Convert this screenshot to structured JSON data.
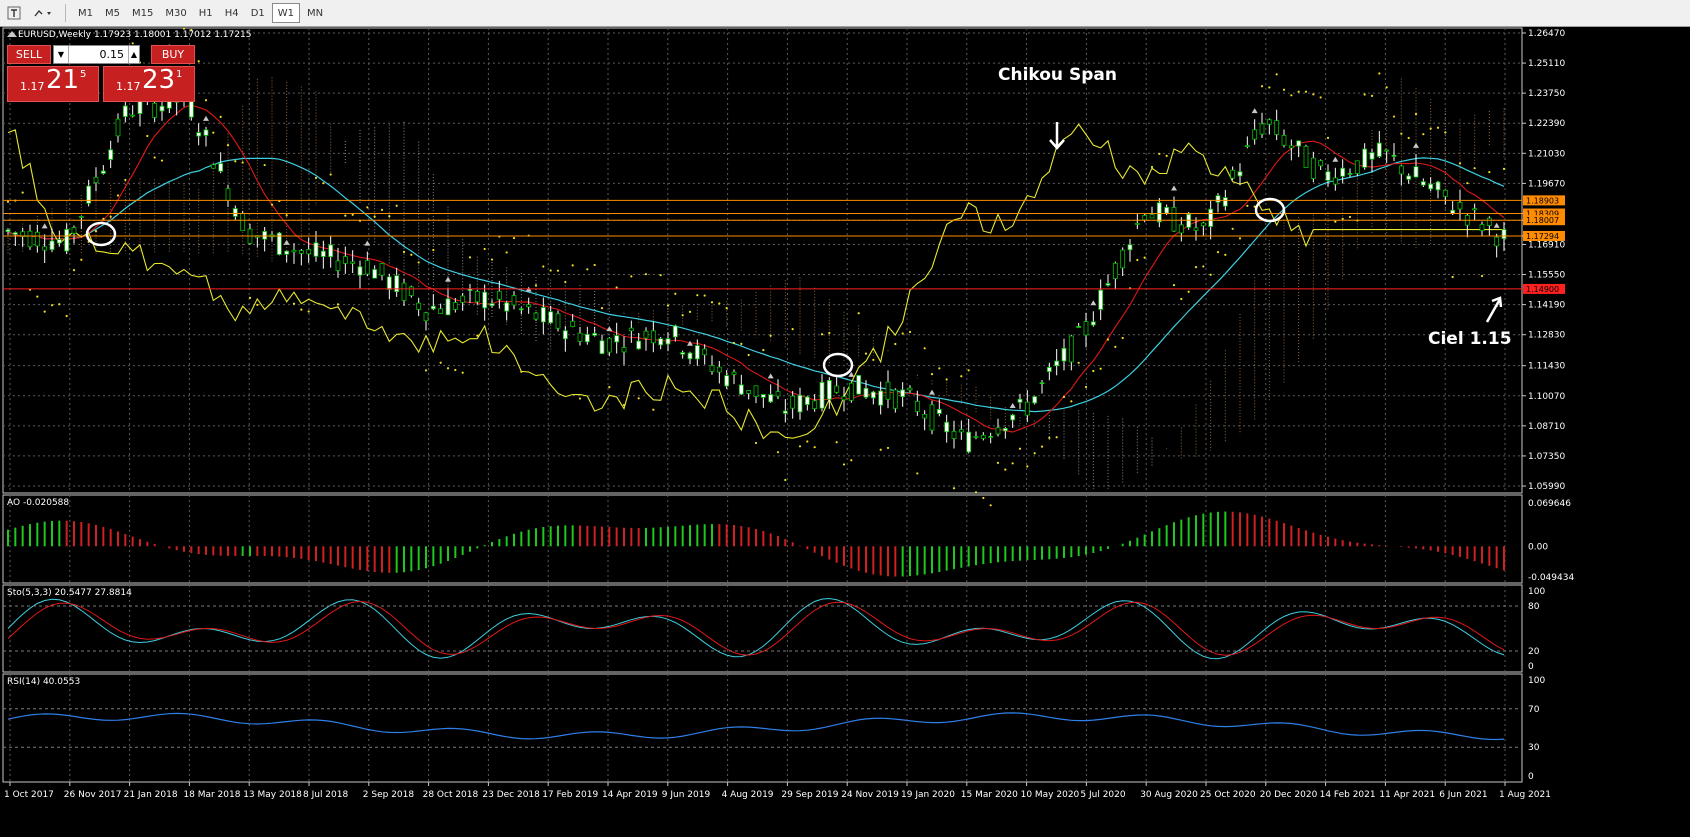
{
  "toolbar": {
    "timeframes": [
      "M1",
      "M5",
      "M15",
      "M30",
      "H1",
      "H4",
      "D1",
      "W1",
      "MN"
    ],
    "active": "W1"
  },
  "main_chart": {
    "header": "EURUSD,Weekly  1.17923 1.18001 1.17012 1.17215",
    "price_ticks": [
      "1.26470",
      "1.25110",
      "1.23750",
      "1.22390",
      "1.21030",
      "1.19670",
      "1.18309",
      "1.18007",
      "1.17294",
      "1.16910",
      "1.15550",
      "1.14190",
      "1.12830",
      "1.11430",
      "1.10070",
      "1.08710",
      "1.07350",
      "1.05990"
    ],
    "price_range": [
      1.0599,
      1.2647
    ],
    "level_labels": [
      {
        "text": "1.18903",
        "price": 1.18903,
        "color": "#ff8c00"
      },
      {
        "text": "1.18309",
        "price": 1.18309,
        "color": "#ff8c00"
      },
      {
        "text": "1.18007",
        "price": 1.18007,
        "color": "#ff8c00"
      },
      {
        "text": "1.17294",
        "price": 1.17294,
        "color": "#ff8c00"
      },
      {
        "text": "1.14900",
        "price": 1.149,
        "color": "#ff2020"
      }
    ],
    "annotations": {
      "chikou": "Chikou Span",
      "ciel": "Ciel 1.15"
    }
  },
  "trade_panel": {
    "sell_label": "SELL",
    "buy_label": "BUY",
    "lot": "0.15",
    "sell_small": "1.17",
    "sell_big": "21",
    "sell_pip": "5",
    "buy_small": "1.17",
    "buy_big": "23",
    "buy_pip": "1"
  },
  "ao_panel": {
    "header": "AO -0.020588",
    "ticks": [
      "0.069646",
      "0.00",
      "-0.049434"
    ],
    "range": [
      -0.049434,
      0.069646
    ]
  },
  "sto_panel": {
    "header": "Sto(5,3,3) 20.5477 27.8814",
    "ticks": [
      "100",
      "80",
      "20",
      "0"
    ]
  },
  "rsi_panel": {
    "header": "RSI(14) 40.0553",
    "ticks": [
      "100",
      "70",
      "30",
      "0"
    ]
  },
  "time_axis": [
    "1 Oct 2017",
    "26 Nov 2017",
    "21 Jan 2018",
    "18 Mar 2018",
    "13 May 2018",
    "8 Jul 2018",
    "2 Sep 2018",
    "28 Oct 2018",
    "23 Dec 2018",
    "17 Feb 2019",
    "14 Apr 2019",
    "9 Jun 2019",
    "4 Aug 2019",
    "29 Sep 2019",
    "24 Nov 2019",
    "19 Jan 2020",
    "15 Mar 2020",
    "10 May 2020",
    "5 Jul 2020",
    "30 Aug 2020",
    "25 Oct 2020",
    "20 Dec 2020",
    "14 Feb 2021",
    "11 Apr 2021",
    "6 Jun 2021",
    "1 Aug 2021"
  ],
  "chart_data": {
    "type": "line",
    "title": "EURUSD,Weekly",
    "symbol": "EURUSD",
    "timeframe": "Weekly",
    "last_bar": {
      "open": 1.17923,
      "high": 1.18001,
      "low": 1.17012,
      "close": 1.17215
    },
    "price_key_points": [
      {
        "x": "1 Oct 2017",
        "y": 1.175
      },
      {
        "x": "26 Nov 2017",
        "y": 1.17
      },
      {
        "x": "21 Jan 2018",
        "y": 1.23
      },
      {
        "x": "18 Mar 2018",
        "y": 1.235
      },
      {
        "x": "13 May 2018",
        "y": 1.175
      },
      {
        "x": "8 Jul 2018",
        "y": 1.165
      },
      {
        "x": "2 Sep 2018",
        "y": 1.16
      },
      {
        "x": "28 Oct 2018",
        "y": 1.14
      },
      {
        "x": "23 Dec 2018",
        "y": 1.145
      },
      {
        "x": "17 Feb 2019",
        "y": 1.135
      },
      {
        "x": "14 Apr 2019",
        "y": 1.125
      },
      {
        "x": "9 Jun 2019",
        "y": 1.13
      },
      {
        "x": "4 Aug 2019",
        "y": 1.11
      },
      {
        "x": "29 Sep 2019",
        "y": 1.095
      },
      {
        "x": "24 Nov 2019",
        "y": 1.105
      },
      {
        "x": "19 Jan 2020",
        "y": 1.1
      },
      {
        "x": "15 Mar 2020",
        "y": 1.08
      },
      {
        "x": "10 May 2020",
        "y": 1.095
      },
      {
        "x": "5 Jul 2020",
        "y": 1.13
      },
      {
        "x": "30 Aug 2020",
        "y": 1.185
      },
      {
        "x": "25 Oct 2020",
        "y": 1.175
      },
      {
        "x": "20 Dec 2020",
        "y": 1.225
      },
      {
        "x": "14 Feb 2021",
        "y": 1.2
      },
      {
        "x": "11 Apr 2021",
        "y": 1.21
      },
      {
        "x": "6 Jun 2021",
        "y": 1.19
      },
      {
        "x": "1 Aug 2021",
        "y": 1.172
      }
    ],
    "horizontal_levels": [
      1.18903,
      1.18309,
      1.18007,
      1.17294,
      1.149
    ],
    "ylim": [
      1.0599,
      1.2647
    ],
    "grid": true,
    "indicators": [
      "Ichimoku",
      "Parabolic SAR",
      "AO",
      "Sto(5,3,3)",
      "RSI(14)"
    ]
  }
}
